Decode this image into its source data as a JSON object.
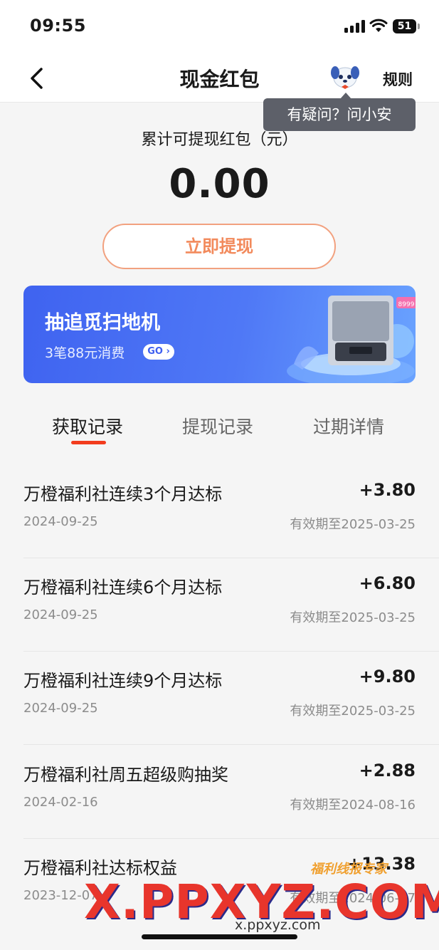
{
  "status_bar": {
    "time": "09:55",
    "battery": "51"
  },
  "nav": {
    "title": "现金红包",
    "rules_label": "规则"
  },
  "tooltip": {
    "text": "有疑问？问小安"
  },
  "balance": {
    "label": "累计可提现红包（元）",
    "amount": "0.00",
    "withdraw_label": "立即提现"
  },
  "banner": {
    "title": "抽追觅扫地机",
    "subtitle": "3笔88元消费",
    "go_label": "GO",
    "price_tag": "8999"
  },
  "tabs": [
    {
      "label": "获取记录",
      "active": true
    },
    {
      "label": "提现记录",
      "active": false
    },
    {
      "label": "过期详情",
      "active": false
    }
  ],
  "records": [
    {
      "title": "万橙福利社连续3个月达标",
      "amount": "+3.80",
      "date": "2024-09-25",
      "expiry": "有效期至2025-03-25"
    },
    {
      "title": "万橙福利社连续6个月达标",
      "amount": "+6.80",
      "date": "2024-09-25",
      "expiry": "有效期至2025-03-25"
    },
    {
      "title": "万橙福利社连续9个月达标",
      "amount": "+9.80",
      "date": "2024-09-25",
      "expiry": "有效期至2025-03-25"
    },
    {
      "title": "万橙福利社周五超级购抽奖",
      "amount": "+2.88",
      "date": "2024-02-16",
      "expiry": "有效期至2024-08-16"
    },
    {
      "title": "万橙福利社达标权益",
      "amount": "+13.38",
      "date": "2023-12-07",
      "expiry": "有效期至2024-06-07"
    }
  ],
  "watermark": {
    "logo_text": "福利线报专家",
    "big_text": "X.PPXYZ.COM",
    "small_text": "x.ppxyz.com"
  },
  "colors": {
    "accent_red": "#f23c1e",
    "withdraw_orange": "#f28a5c",
    "banner_blue": "#4f78f6",
    "tooltip_bg": "#5d6069"
  }
}
